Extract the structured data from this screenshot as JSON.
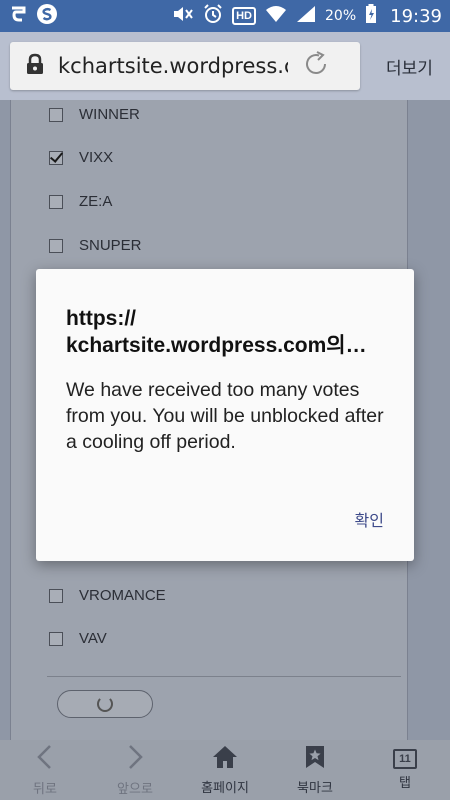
{
  "status_bar": {
    "time": "19:39",
    "battery": "20%",
    "icons": [
      "sync-icon",
      "samsung-s-icon",
      "mute-icon",
      "alarm-icon",
      "hd-voice-icon",
      "wifi-icon",
      "signal-icon",
      "battery-charging-icon"
    ],
    "hd_label": "HD"
  },
  "browser": {
    "url": "kchartsite.wordpress.com",
    "more_label": "더보기"
  },
  "poll": {
    "options_top": [
      {
        "label": "WINNER",
        "checked": false
      },
      {
        "label": "VIXX",
        "checked": true
      },
      {
        "label": "ZE:A",
        "checked": false
      },
      {
        "label": "SNUPER",
        "checked": false
      }
    ],
    "options_bottom": [
      {
        "label": "VROMANCE",
        "checked": false
      },
      {
        "label": "VAV",
        "checked": false
      }
    ]
  },
  "dialog": {
    "title_line1": "https://",
    "title_line2": "kchartsite.wordpress.com의…",
    "message": "We have received too many votes from you. You will be unblocked after a cooling off period.",
    "ok_label": "확인"
  },
  "bottom_nav": {
    "back_label": "뒤로",
    "forward_label": "앞으로",
    "home_label": "홈페이지",
    "bookmark_label": "북마크",
    "tabs_label": "탭",
    "tab_count": "11"
  }
}
